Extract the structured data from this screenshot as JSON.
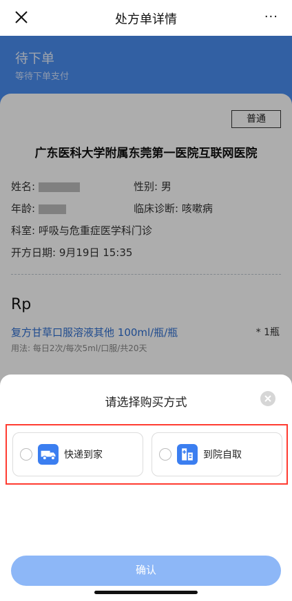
{
  "nav": {
    "title": "处方单详情",
    "more": "···"
  },
  "status": {
    "title": "待下单",
    "subtitle": "等待下单支付"
  },
  "card": {
    "badge": "普通",
    "hospital": "广东医科大学附属东莞第一医院互联网医院",
    "name_label": "姓名:",
    "gender_label": "性别:",
    "gender_value": "男",
    "age_label": "年龄:",
    "diagnosis_label": "临床诊断:",
    "diagnosis_value": "咳嗽病",
    "department": "科室: 呼吸与危重症医学科门诊",
    "date": "开方日期: 9月19日 15:35",
    "rp": "Rp",
    "drug_name": "复方甘草口服溶液其他 100ml/瓶/瓶",
    "drug_qty": "* 1瓶",
    "drug_usage": "用法: 每日2次/每次5ml/口服/共20天"
  },
  "sheet": {
    "title": "请选择购买方式",
    "options": [
      {
        "label": "快递到家",
        "icon": "truck-icon"
      },
      {
        "label": "到院自取",
        "icon": "hospital-icon"
      }
    ],
    "confirm_label": "确认"
  },
  "colors": {
    "primary": "#3b7ef0",
    "header_blue": "#4a8ef0",
    "confirm_disabled": "#8db7f7",
    "highlight_red": "#ff3b30"
  }
}
